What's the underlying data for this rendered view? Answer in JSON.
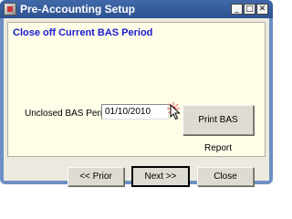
{
  "window": {
    "title": "Pre-Accounting Setup",
    "minimize_glyph": "_",
    "maximize_glyph": "□",
    "close_glyph": "✕"
  },
  "panel": {
    "heading": "Close off Current BAS Period",
    "unclosed_label": "Unclosed BAS Period",
    "unclosed_value": "01/10/2010",
    "print_button": "Print BAS Report"
  },
  "footer": {
    "prior_button": "<< Prior",
    "next_button": "Next >>",
    "close_button": "Close"
  },
  "colors": {
    "heading_text": "#1a1ad0",
    "panel_background": "#fdfde8",
    "titlebar": "#3a60a0"
  },
  "icons": [
    "app-icon",
    "minimize-icon",
    "maximize-icon",
    "close-icon",
    "mouse-pointer-icon",
    "click-spark-icon"
  ]
}
